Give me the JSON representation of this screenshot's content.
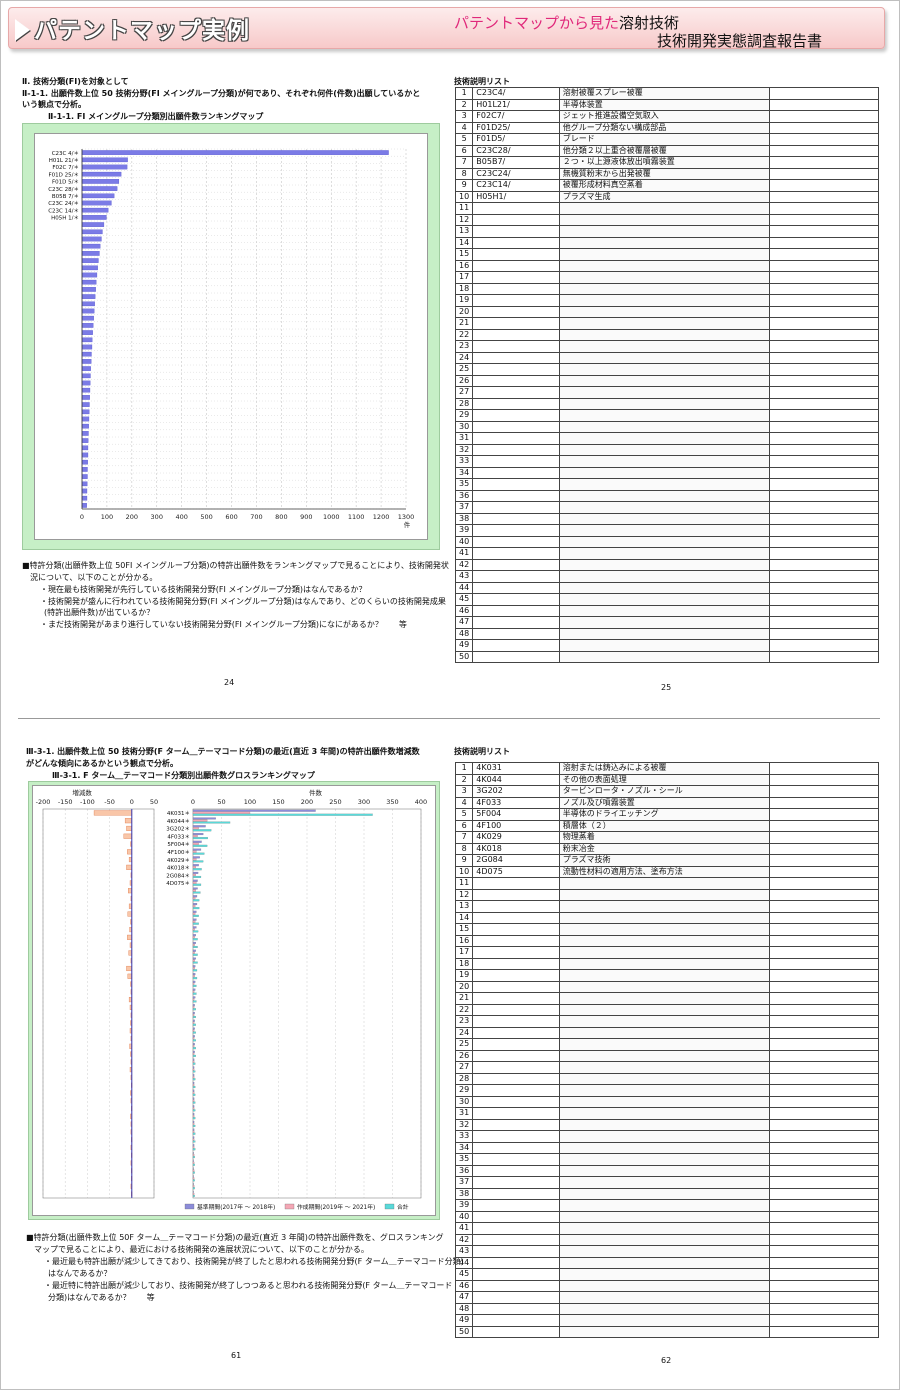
{
  "banner": {
    "title": "パテントマップ実例",
    "sub_prefix": "パテントマップから見た",
    "sub_suffix": "溶射技術",
    "sub2": "技術開発実態調査報告書"
  },
  "sec1": {
    "heading": "Ⅱ. 技術分類(FI)を対象として",
    "lead1": "Ⅱ-1-1. 出願件数上位 50 技術分野(FI メイングループ分類)が何であり、それぞれ何件(件数)出願しているかと",
    "lead2": "いう観点で分析。",
    "caption": "Ⅱ-1-1. FI メイングループ分類別出願件数ランキングマップ",
    "notes": [
      "■特許分類(出願件数上位 50FI メイングループ分類)の特許出願件数をランキングマップで見ることにより、技術開発状",
      "況について、以下のことが分かる。",
      "・現在最も技術開発が先行している技術開発分野(FI メイングループ分類)はなんであるか？",
      "・技術開発が盛んに行われている技術開発分野(FI メイングループ分類)はなんであり、どのくらいの技術開発成果",
      "(特許出願件数)が出ているか？",
      "・まだ技術開発があまり進行していない技術開発分野(FI メイングループ分類)になにがあるか？　　等"
    ],
    "page_left": "24",
    "page_right": "25",
    "table_title": "技術説明リスト",
    "rows": [
      [
        "1",
        "C23C4/",
        "溶射被覆スプレー被覆"
      ],
      [
        "2",
        "H01L21/",
        "半導体装置"
      ],
      [
        "3",
        "F02C7/",
        "ジェット推進設備空気取入"
      ],
      [
        "4",
        "F01D25/",
        "他グループ分類ない構成部品"
      ],
      [
        "5",
        "F01D5/",
        "ブレード"
      ],
      [
        "6",
        "C23C28/",
        "他分類２以上重合被覆層被覆"
      ],
      [
        "7",
        "B05B7/",
        "２つ・以上源液体放出噴霧装置"
      ],
      [
        "8",
        "C23C24/",
        "無機質粉末から出発被覆"
      ],
      [
        "9",
        "C23C14/",
        "被覆形成材料真空蒸着"
      ],
      [
        "10",
        "H05H1/",
        "プラズマ生成"
      ]
    ]
  },
  "sec2": {
    "lead1": "Ⅲ-3-1. 出願件数上位 50 技術分野(F ターム＿テーマコード分類)の最近(直近 3 年間)の特許出願件数増減数",
    "lead2": "がどんな傾向にあるかという観点で分析。",
    "caption": "Ⅲ-3-1. F ターム＿テーマコード分類別出願件数グロスランキングマップ",
    "notes": [
      "■特許分類(出願件数上位 50F ターム＿テーマコード分類)の最近(直近 3 年間)の特許出願件数を、グロスランキング",
      "マップで見ることにより、最近における技術開発の進展状況について、以下のことが分かる。",
      "・最近最も特許出願が減少してきており、技術開発が終了したと思われる技術開発分野(F ターム＿テーマコード分類)",
      "はなんであるか？",
      "・最近特に特許出願が減少しており、技術開発が終了しつつあると思われる技術開発分野(F ターム＿テーマコード",
      "分類)はなんであるか？　　等"
    ],
    "page_left": "61",
    "page_right": "62",
    "table_title": "技術説明リスト",
    "rows": [
      [
        "1",
        "4K031",
        "溶射または鋳込みによる被覆"
      ],
      [
        "2",
        "4K044",
        "その他の表面処理"
      ],
      [
        "3",
        "3G202",
        "タービンロータ・ノズル・シール"
      ],
      [
        "4",
        "4F033",
        "ノズル及び噴霧装置"
      ],
      [
        "5",
        "5F004",
        "半導体のドライエッチング"
      ],
      [
        "6",
        "4F100",
        "積層体（２）"
      ],
      [
        "7",
        "4K029",
        "物理蒸着"
      ],
      [
        "8",
        "4K018",
        "粉末冶金"
      ],
      [
        "9",
        "2G084",
        "プラズマ技術"
      ],
      [
        "10",
        "4D075",
        "流動性材料の適用方法、塗布方法"
      ]
    ]
  },
  "chart_data": [
    {
      "type": "bar",
      "orientation": "horizontal",
      "categories": [
        "C23C 4/＊",
        "H01L 21/＊",
        "F02C 7/＊",
        "F01D 25/＊",
        "F01D 5/＊",
        "C23C 28/＊",
        "B05B 7/＊",
        "C23C 24/＊",
        "C23C 14/＊",
        "H05H 1/＊"
      ],
      "values": [
        1230,
        183,
        181,
        157,
        148,
        141,
        129,
        118,
        105,
        98,
        88,
        82,
        78,
        73,
        70,
        66,
        63,
        60,
        57,
        55,
        53,
        51,
        49,
        47,
        45,
        43,
        41,
        40,
        38,
        37,
        35,
        34,
        33,
        32,
        31,
        30,
        29,
        28,
        27,
        26,
        25,
        24,
        24,
        23,
        22,
        22,
        21,
        20,
        20,
        19
      ],
      "xlim": [
        0,
        1300
      ],
      "xticks": [
        0,
        100,
        200,
        300,
        400,
        500,
        600,
        700,
        800,
        900,
        1000,
        1100,
        1200,
        1300
      ],
      "xunit": "件",
      "color": "#7b7be6"
    },
    {
      "type": "bar",
      "orientation": "horizontal",
      "categories": [
        "4K031＊",
        "4K044＊",
        "3G202＊",
        "4F033＊",
        "5F004＊",
        "4F100＊",
        "4K029＊",
        "4K018＊",
        "2G084＊",
        "4D075＊"
      ],
      "left_axis": {
        "label": "増減数",
        "xlim": [
          -200,
          50
        ],
        "xticks": [
          -200,
          -150,
          -100,
          -50,
          0,
          50
        ]
      },
      "right_axis": {
        "label": "件数",
        "xlim": [
          0,
          400
        ],
        "xticks": [
          0,
          50,
          100,
          150,
          200,
          250,
          300,
          350,
          400
        ]
      },
      "increase": [
        -85,
        -15,
        -12,
        -18,
        -3,
        -10,
        -6,
        -12,
        -2,
        -4,
        -8,
        -2,
        -6,
        -9,
        -3,
        -5,
        -10,
        -4,
        -7,
        -2,
        -12,
        -9,
        -3,
        -2,
        -6,
        -4,
        -2,
        -3,
        -4,
        -2,
        -5,
        -3,
        -2,
        -4,
        -2,
        -1,
        -3,
        -2,
        -1,
        -3,
        -2,
        -2,
        -1,
        -2,
        -1,
        -2,
        -1,
        -1,
        -2,
        -1
      ],
      "series": [
        {
          "name": "基準期間(2017年 ～ 2018年)",
          "color": "#8c8cd9",
          "values": [
            215,
            40,
            22,
            18,
            15,
            14,
            12,
            10,
            9,
            8,
            8,
            7,
            7,
            6,
            6,
            6,
            5,
            5,
            5,
            5,
            4,
            4,
            4,
            4,
            4,
            3,
            3,
            3,
            3,
            3,
            3,
            3,
            2,
            2,
            2,
            2,
            2,
            2,
            2,
            2,
            2,
            2,
            2,
            2,
            1,
            1,
            1,
            1,
            1,
            1
          ]
        },
        {
          "name": "作成期間(2019年 ～ 2021年)",
          "color": "#f4a7b5",
          "values": [
            100,
            25,
            10,
            8,
            10,
            6,
            6,
            5,
            5,
            6,
            5,
            4,
            4,
            4,
            4,
            3,
            3,
            3,
            3,
            3,
            3,
            3,
            2,
            2,
            2,
            2,
            2,
            2,
            2,
            2,
            2,
            2,
            2,
            2,
            2,
            2,
            2,
            2,
            2,
            2,
            2,
            2,
            2,
            2,
            2,
            2,
            2,
            2,
            2,
            2
          ]
        },
        {
          "name": "合計",
          "color": "#59d9d9",
          "values": [
            315,
            65,
            32,
            26,
            25,
            20,
            18,
            15,
            14,
            14,
            13,
            11,
            11,
            10,
            10,
            9,
            8,
            8,
            8,
            8,
            7,
            7,
            6,
            6,
            6,
            5,
            5,
            5,
            5,
            5,
            5,
            5,
            4,
            4,
            4,
            4,
            4,
            4,
            4,
            4,
            4,
            4,
            4,
            4,
            3,
            3,
            3,
            3,
            3,
            3
          ]
        }
      ]
    }
  ]
}
